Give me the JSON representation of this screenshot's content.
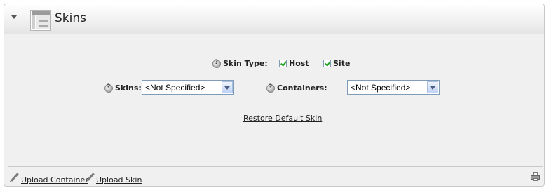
{
  "header": {
    "title": "Skins",
    "collapse_icon": "chevron-down-icon",
    "module_icon": "skins-module-icon"
  },
  "skin_type": {
    "label": "Skin Type:",
    "options": [
      {
        "label": "Host",
        "checked": true
      },
      {
        "label": "Site",
        "checked": true
      }
    ]
  },
  "skins": {
    "label": "Skins:",
    "selected": "<Not Specified>"
  },
  "containers": {
    "label": "Containers:",
    "selected": "<Not Specified>"
  },
  "restore_link": "Restore Default Skin",
  "footer": {
    "upload_container": "Upload Container",
    "upload_skin": "Upload Skin",
    "print_icon": "print-icon"
  },
  "colors": {
    "panel_bg": "#f0f0f0",
    "checkmark": "#21a121",
    "select_border": "#7f9db9"
  }
}
